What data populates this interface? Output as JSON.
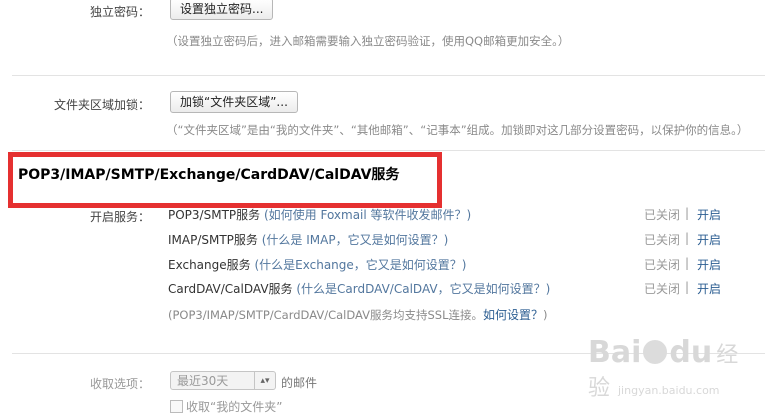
{
  "independent_password": {
    "label": "独立密码：",
    "button": "设置独立密码...",
    "hint": "（设置独立密码后，进入邮箱需要输入独立密码验证，使用QQ邮箱更加安全。）"
  },
  "folder_lock": {
    "label": "文件夹区域加锁：",
    "button": "加锁“文件夹区域”...",
    "hint": "（“文件夹区域”是由“我的文件夹”、“其他邮箱”、“记事本”组成。加锁即对这几部分设置密码，以保护你的信息。）"
  },
  "services": {
    "title": "POP3/IMAP/SMTP/Exchange/CardDAV/CalDAV服务",
    "label": "开启服务：",
    "items": [
      {
        "name": "POP3/SMTP服务",
        "help": "(如何使用 Foxmail 等软件收发邮件？)",
        "status": "已关闭",
        "sep": "|",
        "action": "开启"
      },
      {
        "name": "IMAP/SMTP服务",
        "help": "(什么是 IMAP，它又是如何设置？)",
        "status": "已关闭",
        "sep": "|",
        "action": "开启"
      },
      {
        "name": "Exchange服务",
        "help": "(什么是Exchange，它又是如何设置？)",
        "status": "已关闭",
        "sep": "|",
        "action": "开启"
      },
      {
        "name": "CardDAV/CalDAV服务",
        "help": "(什么是CardDAV/CalDAV，它又是如何设置？)",
        "status": "已关闭",
        "sep": "|",
        "action": "开启"
      }
    ],
    "ssl_note": "(POP3/IMAP/SMTP/CardDAV/CalDAV服务均支持SSL连接。",
    "ssl_link": "如何设置？",
    "ssl_close": ")"
  },
  "receive": {
    "label": "收取选项：",
    "select_value": "最近30天",
    "suffix": "的邮件",
    "checkbox_label": "收取“我的文件夹”"
  },
  "watermark": {
    "brand": "Bai",
    "brand2": "经验",
    "url": "jingyan.baidu.com"
  },
  "colors": {
    "highlight": "#e53030",
    "link": "#2c5e92"
  }
}
